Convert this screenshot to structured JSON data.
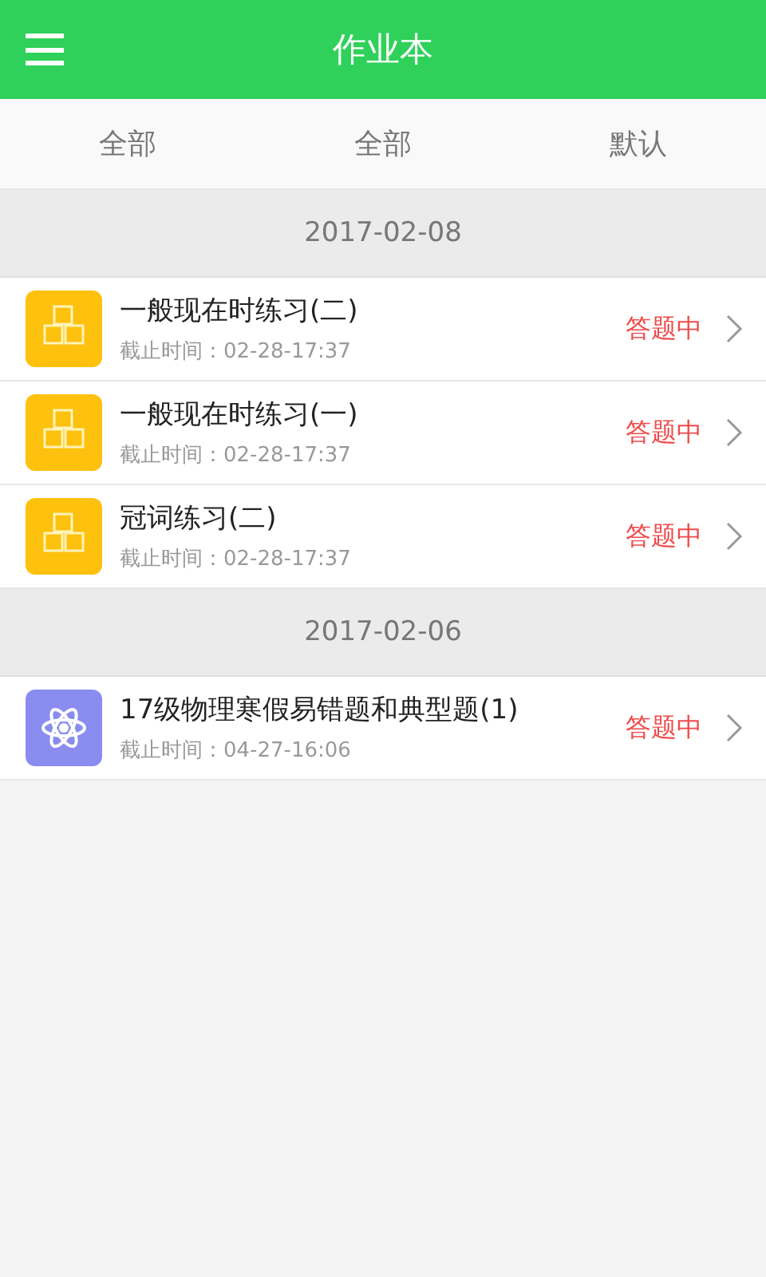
{
  "header": {
    "title": "作业本"
  },
  "filters": [
    "全部",
    "全部",
    "默认"
  ],
  "groups": [
    {
      "date": "2017-02-08",
      "tasks": [
        {
          "kind": "abc",
          "title": "一般现在时练习(二)",
          "deadline": "截止时间：02-28-17:37",
          "status": "答题中"
        },
        {
          "kind": "abc",
          "title": "一般现在时练习(一)",
          "deadline": "截止时间：02-28-17:37",
          "status": "答题中"
        },
        {
          "kind": "abc",
          "title": "冠词练习(二)",
          "deadline": "截止时间：02-28-17:37",
          "status": "答题中"
        }
      ]
    },
    {
      "date": "2017-02-06",
      "tasks": [
        {
          "kind": "atom",
          "title": "17级物理寒假易错题和典型题(1)",
          "deadline": "截止时间：04-27-16:06",
          "status": "答题中"
        }
      ]
    }
  ]
}
